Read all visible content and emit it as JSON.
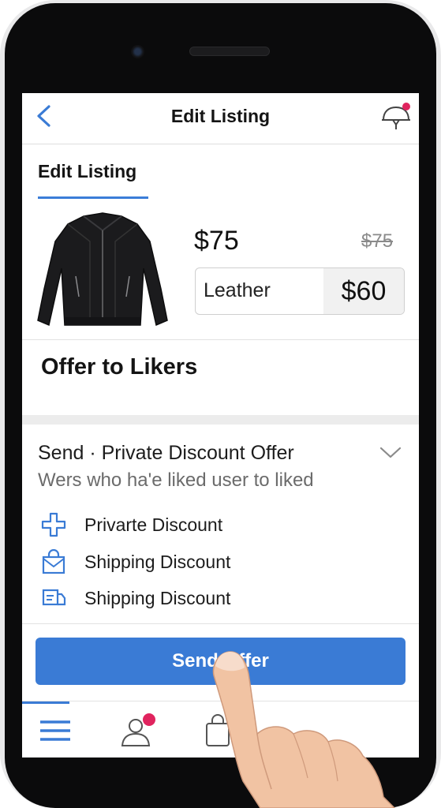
{
  "nav": {
    "title": "Edit Listing",
    "back_icon": "chevron-left-icon",
    "notification_icon": "bell-icon"
  },
  "tab": {
    "label": "Edit Listing"
  },
  "listing": {
    "image": "leather-jacket-image",
    "price": "$75",
    "original_price": "$75",
    "variant_label": "Leather",
    "variant_price": "$60"
  },
  "section": {
    "title": "Offer to Likers"
  },
  "offer": {
    "title": "Send · Private Discount Offer",
    "subtitle": "Wers who ha'e liked  user to liked",
    "options": [
      {
        "icon": "plus-icon",
        "label": "Privarte Discount"
      },
      {
        "icon": "shopping-bag-icon",
        "label": "Shipping Discount"
      },
      {
        "icon": "truck-icon",
        "label": "Shipping Discount"
      }
    ]
  },
  "button": {
    "label": "Send Offer"
  },
  "tabbar": {
    "items": [
      {
        "icon": "menu-icon"
      },
      {
        "icon": "profile-icon"
      },
      {
        "icon": "bag-icon"
      }
    ]
  },
  "colors": {
    "accent": "#3a7bd5",
    "badge": "#e0245e"
  }
}
